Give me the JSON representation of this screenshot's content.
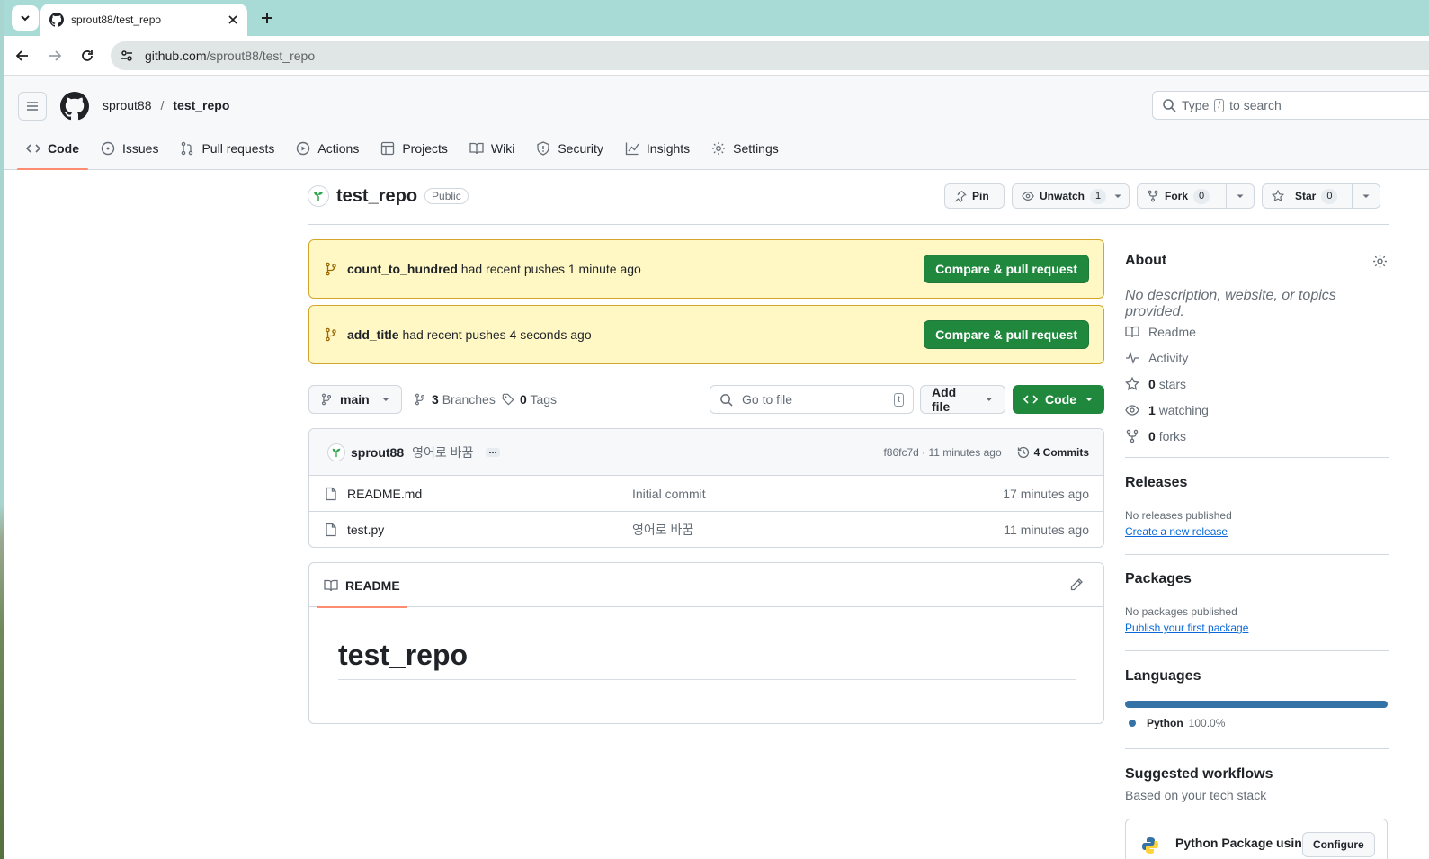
{
  "browser": {
    "tab_title": "sprout88/test_repo",
    "url_host": "github.com",
    "url_path": "/sprout88/test_repo"
  },
  "header": {
    "owner": "sprout88",
    "separator": "/",
    "repo": "test_repo",
    "search_before": "Type",
    "search_key": "/",
    "search_after": "to search"
  },
  "nav": {
    "code": "Code",
    "issues": "Issues",
    "pulls": "Pull requests",
    "actions": "Actions",
    "projects": "Projects",
    "wiki": "Wiki",
    "security": "Security",
    "insights": "Insights",
    "settings": "Settings"
  },
  "repo": {
    "name": "test_repo",
    "visibility": "Public",
    "pin": "Pin",
    "unwatch": "Unwatch",
    "watch_count": "1",
    "fork": "Fork",
    "fork_count": "0",
    "star": "Star",
    "star_count": "0"
  },
  "banners": [
    {
      "branch": "count_to_hundred",
      "text": "had recent pushes 1 minute ago",
      "button": "Compare & pull request"
    },
    {
      "branch": "add_title",
      "text": "had recent pushes 4 seconds ago",
      "button": "Compare & pull request"
    }
  ],
  "toolbar": {
    "branch": "main",
    "branches_count": "3",
    "branches_label": "Branches",
    "tags_count": "0",
    "tags_label": "Tags",
    "goto_placeholder": "Go to file",
    "goto_key": "t",
    "add_file": "Add file",
    "code": "Code"
  },
  "commit": {
    "author": "sprout88",
    "message": "영어로 바꿈",
    "sha_time": "f86fc7d · 11 minutes ago",
    "commits": "4 Commits"
  },
  "files": [
    {
      "name": "README.md",
      "message": "Initial commit",
      "time": "17 minutes ago"
    },
    {
      "name": "test.py",
      "message": "영어로 바꿈",
      "time": "11 minutes ago"
    }
  ],
  "readme": {
    "tab": "README",
    "heading": "test_repo"
  },
  "about": {
    "title": "About",
    "description": "No description, website, or topics provided.",
    "readme": "Readme",
    "activity": "Activity",
    "stars_count": "0",
    "stars_label": "stars",
    "watching_count": "1",
    "watching_label": "watching",
    "forks_count": "0",
    "forks_label": "forks"
  },
  "releases": {
    "title": "Releases",
    "none": "No releases published",
    "create": "Create a new release"
  },
  "packages": {
    "title": "Packages",
    "none": "No packages published",
    "publish": "Publish your first package"
  },
  "languages": {
    "title": "Languages",
    "items": [
      {
        "name": "Python",
        "percent": "100.0%",
        "fraction": 1.0,
        "color": "#3572A5"
      }
    ]
  },
  "workflows": {
    "title": "Suggested workflows",
    "subtitle": "Based on your tech stack",
    "card_title": "Python Package using",
    "card_button": "Configure"
  },
  "colors": {
    "accent_green": "#1f883d",
    "banner_bg": "#fff8c5",
    "link": "#0969da",
    "tab_underline": "#fd8c73"
  }
}
